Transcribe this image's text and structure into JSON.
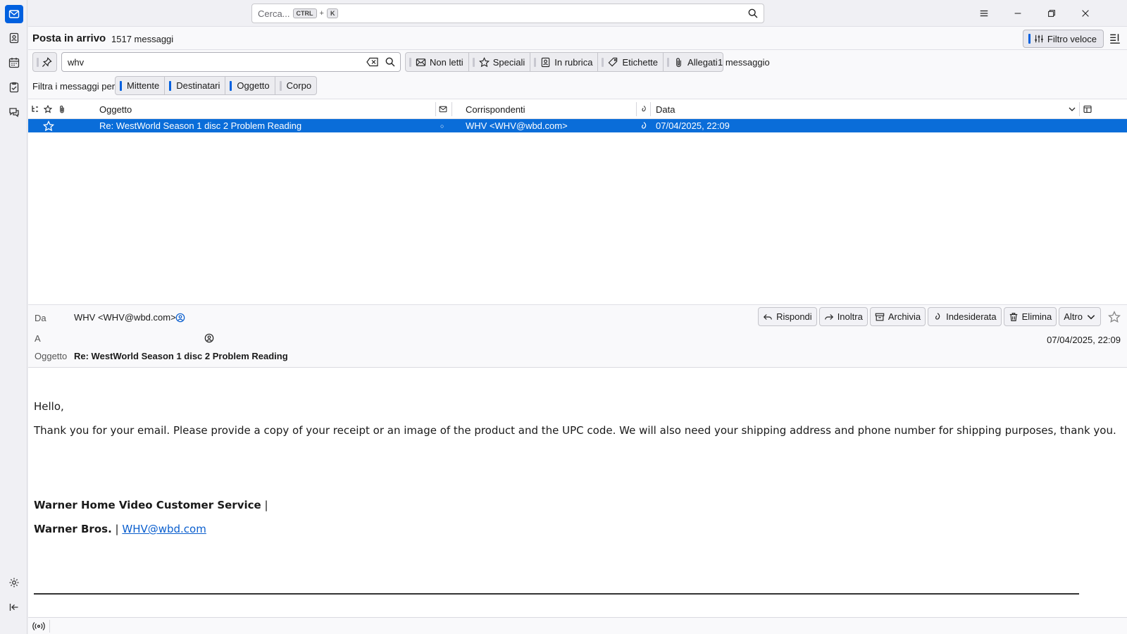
{
  "spaces": {
    "items": [
      {
        "name": "mail",
        "icon": "mail-icon",
        "active": true
      },
      {
        "name": "address-book",
        "icon": "address-book-icon"
      },
      {
        "name": "calendar",
        "icon": "calendar-icon"
      },
      {
        "name": "tasks",
        "icon": "tasks-icon"
      },
      {
        "name": "chat",
        "icon": "chat-icon"
      }
    ],
    "bottom": [
      "settings-icon",
      "collapse-icon"
    ]
  },
  "titlebar": {
    "search_placeholder": "Cerca...",
    "shortcut_key1": "CTRL",
    "shortcut_plus": "+",
    "shortcut_key2": "K"
  },
  "folder": {
    "name": "Posta in arrivo",
    "count": "1517 messaggi",
    "quick_filter_label": "Filtro veloce"
  },
  "quick_filter": {
    "search_value": "whv",
    "toggles": [
      "Non letti",
      "Speciali",
      "In rubrica",
      "Etichette",
      "Allegati"
    ],
    "result_count": "1 messaggio",
    "filter_by_label": "Filtra i messaggi per:",
    "fields": [
      "Mittente",
      "Destinatari",
      "Oggetto",
      "Corpo"
    ]
  },
  "columns": {
    "subject": "Oggetto",
    "correspondents": "Corrispondenti",
    "date": "Data"
  },
  "rows": [
    {
      "subject": "Re: WestWorld Season 1 disc 2 Problem Reading",
      "correspondent": "WHV <WHV@wbd.com>",
      "date": "07/04/2025, 22:09",
      "unread_dot": "○"
    }
  ],
  "message": {
    "from_label": "Da",
    "from_value": "WHV <WHV@wbd.com>",
    "to_label": "A",
    "to_value": "",
    "subject_label": "Oggetto",
    "subject_value": "Re: WestWorld Season 1 disc 2 Problem Reading",
    "date": "07/04/2025, 22:09",
    "actions": [
      "Rispondi",
      "Inoltra",
      "Archivia",
      "Indesiderata",
      "Elimina",
      "Altro"
    ],
    "body": {
      "greeting": "Hello,",
      "paragraph": "Thank you for your email.  Please provide a copy of your receipt or an image of the product and the UPC code.  We will also need your shipping address and phone number for shipping purposes, thank you.",
      "sig_line1": "Warner Home Video Customer Service",
      "sig_line1_sep": " |",
      "sig_line2": "Warner Bros.",
      "sig_line2_sep": " | ",
      "sig_email": "WHV@wbd.com"
    }
  },
  "colors": {
    "accent": "#0060df",
    "selected_row": "#0a6dd9",
    "link": "#0b5fce"
  }
}
